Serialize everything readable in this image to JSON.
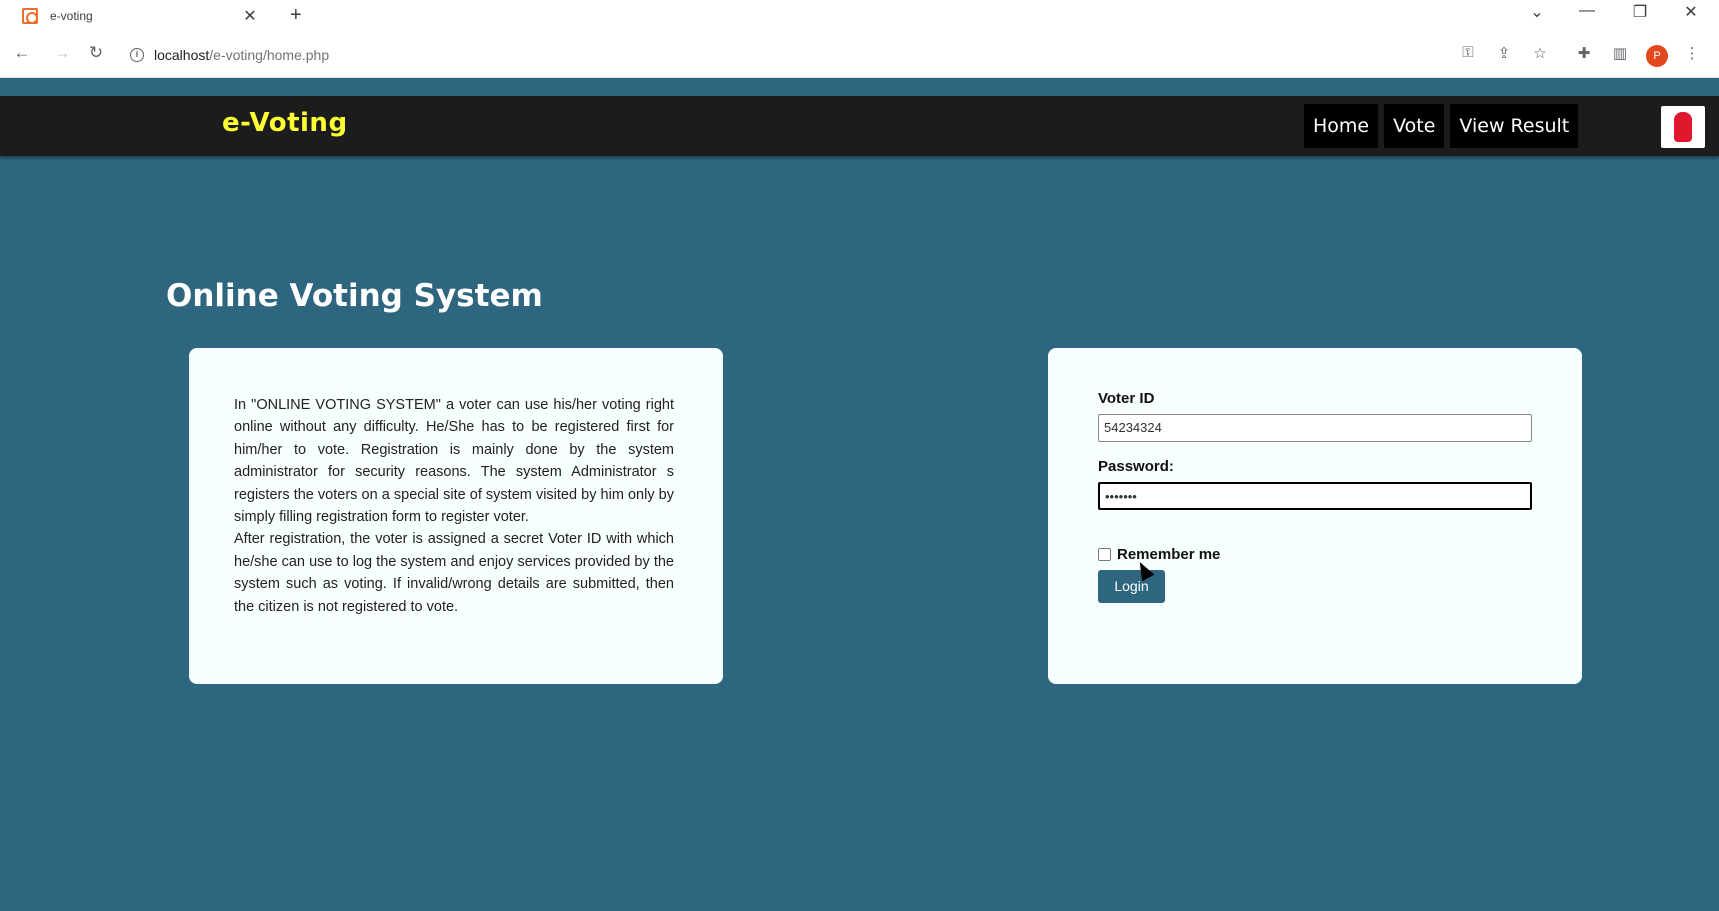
{
  "browser": {
    "tab_title": "e-voting",
    "tab_close": "✕",
    "new_tab": "+",
    "url_host": "localhost",
    "url_path": "/e-voting/home.php",
    "profile_initial": "P",
    "controls": {
      "chevron": "⌄",
      "minimize": "—",
      "restore": "❐",
      "close": "✕"
    },
    "nav": {
      "back": "←",
      "forward": "→",
      "reload": "↻"
    },
    "tools": {
      "key": "⚿",
      "share": "⇪",
      "star": "☆",
      "extensions": "✚",
      "sidebar": "▥",
      "menu": "⋮"
    }
  },
  "navbar": {
    "brand": "e-Voting",
    "menu": [
      "Home",
      "Vote",
      "View Result"
    ]
  },
  "page_title": "Online Voting System",
  "info_card": {
    "paragraph1": "In \"ONLINE VOTING SYSTEM\" a voter can use his/her voting right online without any difficulty. He/She has to be registered first for him/her to vote. Registration is mainly done by the system administrator for security reasons. The system Administrator s registers the voters on a special site of system visited by him only by simply filling registration form to register voter.",
    "paragraph2": "After registration, the voter is assigned a secret Voter ID with which he/she can use to log the system and enjoy services provided by the system such as voting. If invalid/wrong details are submitted, then the citizen is not registered to vote."
  },
  "login_form": {
    "voter_id_label": "Voter ID",
    "voter_id_value": "54234324",
    "password_label": "Password:",
    "password_value": "•••••••",
    "remember_label": "Remember me",
    "remember_checked": false,
    "login_button": "Login"
  },
  "colors": {
    "page_bg": "#2e6680",
    "navbar_bg": "#1c1c1c",
    "brand": "#ffff33",
    "card_bg": "#f7ffff"
  }
}
